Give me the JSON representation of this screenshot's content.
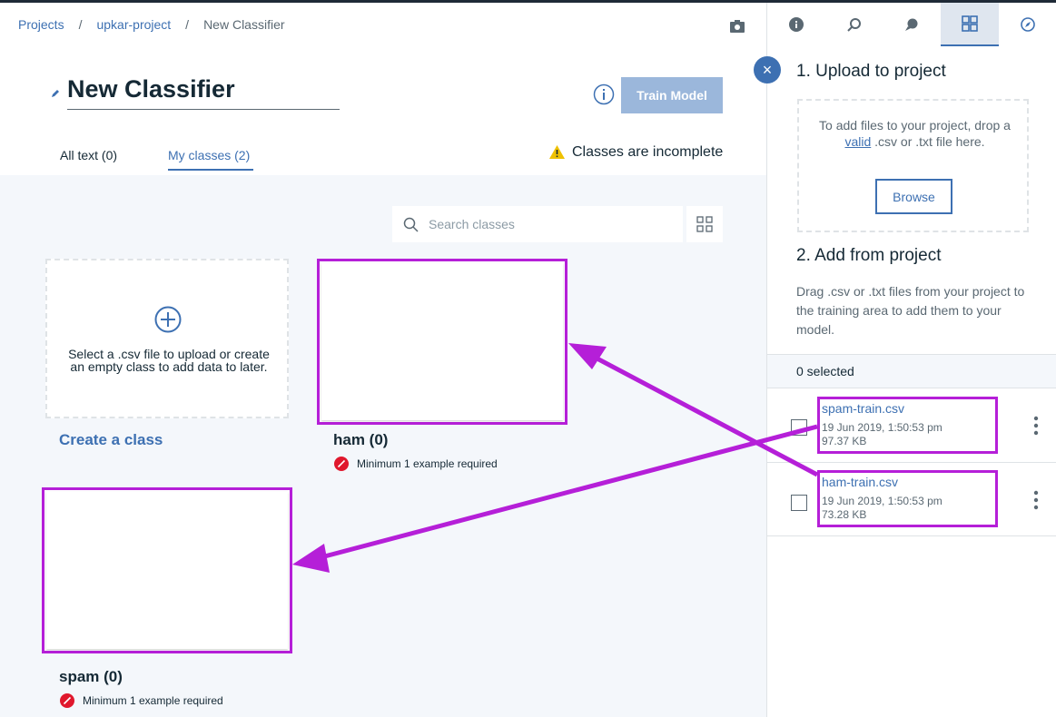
{
  "breadcrumb": {
    "items": [
      "Projects",
      "upkar-project"
    ],
    "current": "New Classifier",
    "separator": "/"
  },
  "title": "New Classifier",
  "train_button": "Train Model",
  "tabs": {
    "all_text": "All text (0)",
    "my_classes": "My classes (2)"
  },
  "warning": "Classes are incomplete",
  "search": {
    "placeholder": "Search classes"
  },
  "create_card": {
    "text": "Select a .csv file to upload or create an empty class to add data to later.",
    "link": "Create a class"
  },
  "classes": [
    {
      "name": "ham (0)",
      "requirement": "Minimum 1 example required"
    },
    {
      "name": "spam (0)",
      "requirement": "Minimum 1 example required"
    }
  ],
  "side_panel": {
    "tabs": [
      "info-icon",
      "search-asset-icon",
      "chat-icon",
      "data-icon",
      "compass-icon"
    ],
    "active_tab": "data-icon",
    "close": "×",
    "upload": {
      "heading": "1. Upload to project",
      "text_before_link": "To add files to your project, drop a ",
      "link": "valid",
      "text_after_link": " .csv or .txt file here.",
      "browse": "Browse"
    },
    "add": {
      "heading": "2. Add from project",
      "description": "Drag .csv or .txt files from your project to the training area to add them to your model."
    },
    "selected": "0 selected",
    "files": [
      {
        "name": "spam-train.csv",
        "date": "19 Jun 2019, 1:50:53 pm",
        "size": "97.37 KB"
      },
      {
        "name": "ham-train.csv",
        "date": "19 Jun 2019, 1:50:53 pm",
        "size": "73.28 KB"
      }
    ]
  },
  "colors": {
    "accent": "#3d70b2",
    "annotation": "#b51fd8",
    "error": "#e0182d",
    "warning": "#efc100"
  }
}
